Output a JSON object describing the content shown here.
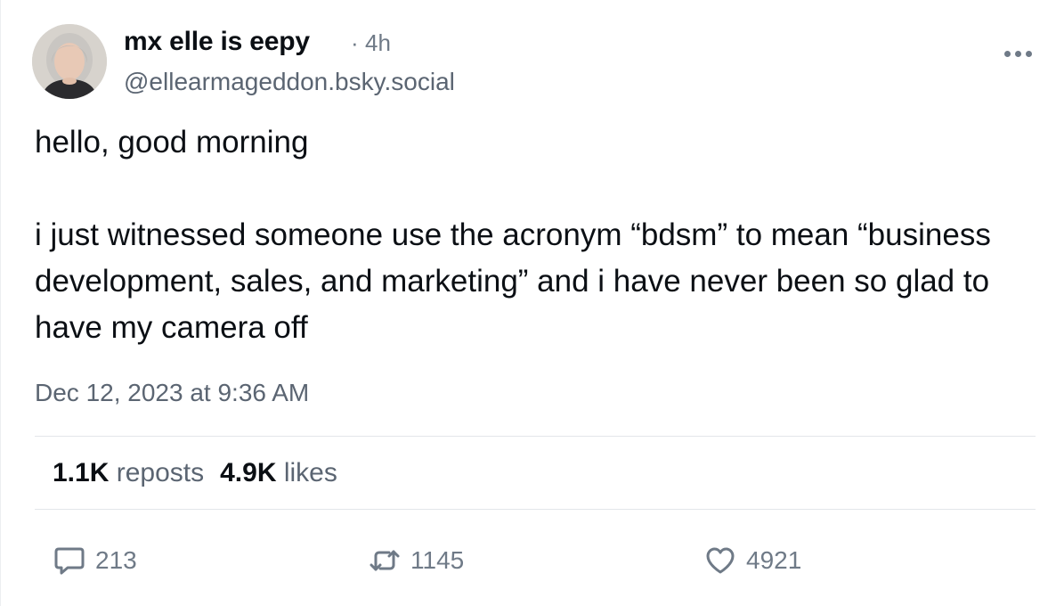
{
  "author": {
    "display_name": "mx elle is eepy",
    "separator": "·",
    "age": "4h",
    "handle": "@ellearmageddon.bsky.social",
    "avatar_icon": "profile-photo"
  },
  "menu": {
    "icon": "more-horizontal-icon"
  },
  "post": {
    "paragraphs": [
      "hello, good morning",
      "i just witnessed someone use the acronym “bdsm” to mean “business development, sales, and marketing” and i have never been so glad to have my camera off"
    ],
    "timestamp": "Dec 12, 2023 at 9:36 AM"
  },
  "stats": {
    "reposts_count": "1.1K",
    "reposts_label": "reposts",
    "likes_count": "4.9K",
    "likes_label": "likes"
  },
  "actions": {
    "reply": {
      "icon": "reply-bubble-icon",
      "count": "213"
    },
    "repost": {
      "icon": "repost-arrows-icon",
      "count": "1145"
    },
    "like": {
      "icon": "heart-icon",
      "count": "4921"
    }
  },
  "colors": {
    "text": "#0b0f14",
    "muted": "#5b6572",
    "icon": "#6f7a87",
    "divider": "#e3e6ea"
  }
}
